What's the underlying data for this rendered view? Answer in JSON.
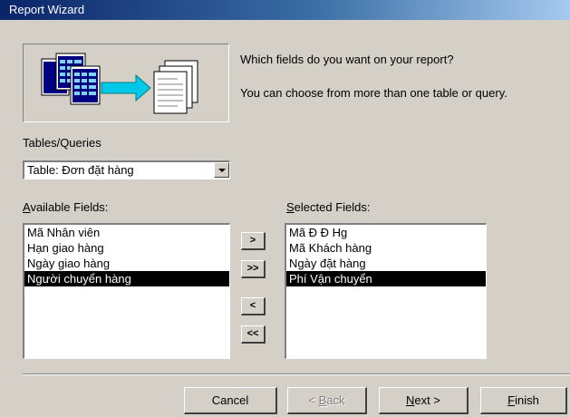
{
  "window": {
    "title": "Report Wizard"
  },
  "prompt": {
    "question": "Which fields do you want on your report?",
    "hint": "You can choose from more than one table or query."
  },
  "tables_queries": {
    "label": "Tables/Queries",
    "selected": "Table: Đơn đặt hàng"
  },
  "available": {
    "label_accel": "A",
    "label_rest": "vailable Fields:",
    "items": [
      "Mã Nhân viên",
      "Hạn giao hàng",
      "Ngày giao hàng",
      "Người chuyển hàng"
    ],
    "selected_index": 3
  },
  "selected": {
    "label_accel": "S",
    "label_rest": "elected Fields:",
    "items": [
      "Mã Đ Đ Hg",
      "Mã Khách hàng",
      "Ngày đặt hàng",
      "Phí Vận chuyển"
    ],
    "selected_index": 3
  },
  "move_buttons": {
    "add_one": ">",
    "add_all": ">>",
    "remove_one": "<",
    "remove_all": "<<"
  },
  "footer": {
    "cancel": "Cancel",
    "back_prefix": "< ",
    "back_accel": "B",
    "back_rest": "ack",
    "next_accel": "N",
    "next_rest": "ext >",
    "finish_accel": "F",
    "finish_rest": "inish"
  },
  "colors": {
    "titlebar_start": "#0a246a",
    "titlebar_end": "#a6caf0",
    "face": "#d4d0c8",
    "selection": "#000000"
  }
}
